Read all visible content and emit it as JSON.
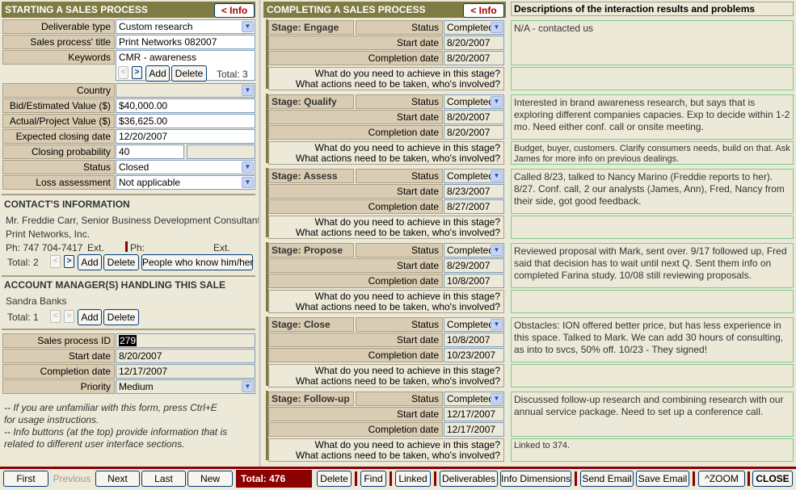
{
  "left": {
    "title": "STARTING A SALES PROCESS",
    "info_label": "< Info",
    "fields": {
      "deliverable_type": {
        "label": "Deliverable type",
        "value": "Custom research"
      },
      "title": {
        "label": "Sales process' title",
        "value": "Print Networks 082007"
      },
      "keywords": {
        "label": "Keywords",
        "value": "CMR - awareness"
      },
      "country": {
        "label": "Country",
        "value": ""
      },
      "bid_value": {
        "label": "Bid/Estimated Value ($)",
        "value": "$40,000.00"
      },
      "actual_value": {
        "label": "Actual/Project Value ($)",
        "value": "$36,625.00"
      },
      "closing_date": {
        "label": "Expected closing date",
        "value": "12/20/2007"
      },
      "probability": {
        "label": "Closing probability",
        "value": "40"
      },
      "status": {
        "label": "Status",
        "value": "Closed"
      },
      "loss": {
        "label": "Loss assessment",
        "value": "Not applicable"
      }
    },
    "keywords_nav": {
      "prev": "<",
      "next": ">",
      "add": "Add",
      "delete": "Delete",
      "total": "Total: 3"
    },
    "contact": {
      "title": "CONTACT'S INFORMATION",
      "name": "Mr. Freddie Carr, Senior Business Development Consultant",
      "company": "Print Networks, Inc.",
      "ph_label": "Ph:",
      "ph": "747 704-7417",
      "ext_label": "Ext.",
      "ph2_label": "Ph:",
      "ext2_label": "Ext.",
      "total": "Total: 2",
      "prev": "<",
      "next": ">",
      "add": "Add",
      "delete": "Delete",
      "people": "People who know him/her"
    },
    "account": {
      "title": "ACCOUNT MANAGER(S) HANDLING THIS SALE",
      "name": "Sandra Banks",
      "total": "Total: 1",
      "prev": "<",
      "next": ">",
      "add": "Add",
      "delete": "Delete"
    },
    "process": {
      "id": {
        "label": "Sales process ID",
        "value": "279"
      },
      "start": {
        "label": "Start date",
        "value": "8/20/2007"
      },
      "completion": {
        "label": "Completion date",
        "value": "12/17/2007"
      },
      "priority": {
        "label": "Priority",
        "value": "Medium"
      }
    },
    "notes": [
      "-- If you are unfamiliar with this form, press Ctrl+E",
      "for usage instructions.",
      "-- Info buttons (at the top) provide information that is",
      "related to different user interface sections."
    ]
  },
  "center": {
    "title": "COMPLETING A SALES PROCESS",
    "info_label": "< Info",
    "labels": {
      "status": "Status",
      "start": "Start date",
      "completion": "Completion date",
      "q1": "What do you need to achieve in this stage?",
      "q2": "What actions need to be taken, who's involved?"
    },
    "stages": [
      {
        "name": "Stage: Engage",
        "status": "Completed",
        "start": "8/20/2007",
        "completion": "8/20/2007",
        "desc": "N/A - contacted us",
        "answer": ""
      },
      {
        "name": "Stage: Qualify",
        "status": "Completed",
        "start": "8/20/2007",
        "completion": "8/20/2007",
        "desc": "Interested in brand awareness research, but says that is exploring different companies capacies. Exp to decide within 1-2 mo. Need either conf. call or onsite meeting.",
        "answer": "Budget, buyer, customers. Clarify consumers needs, build on that. Ask James for more info on previous dealings."
      },
      {
        "name": "Stage: Assess",
        "status": "Completed",
        "start": "8/23/2007",
        "completion": "8/27/2007",
        "desc": "Called 8/23, talked to Nancy Marino (Freddie reports to her). 8/27. Conf. call, 2 our analysts (James, Ann), Fred, Nancy from their side, got good feedback.",
        "answer": ""
      },
      {
        "name": "Stage: Propose",
        "status": "Completed",
        "start": "8/29/2007",
        "completion": "10/8/2007",
        "desc": "Reviewed proposal with Mark, sent over. 9/17 followed up, Fred said that decision has to wait until next Q. Sent them info on completed Farina study. 10/08 still reviewing proposals.",
        "answer": ""
      },
      {
        "name": "Stage: Close",
        "status": "Completed",
        "start": "10/8/2007",
        "completion": "10/23/2007",
        "desc": "Obstacles: ION offered better price, but has less experience in this space. Talked to Mark. We can add 30 hours of consulting, as into to svcs, 50% off. 10/23 - They signed!",
        "answer": ""
      },
      {
        "name": "Stage: Follow-up",
        "status": "Completed",
        "start": "12/17/2007",
        "completion": "12/17/2007",
        "desc": "Discussed follow-up research and combining research with our annual service package. Need to set up a conference call.",
        "answer": "Linked to 374."
      }
    ]
  },
  "right": {
    "title": "Descriptions of the interaction results and problems"
  },
  "bottom": {
    "first": "First",
    "previous": "Previous",
    "next": "Next",
    "last": "Last",
    "new": "New",
    "total": "Total: 476",
    "delete": "Delete",
    "find": "Find",
    "linked": "Linked",
    "deliverables": "Deliverables",
    "info_dimensions": "Info Dimensions",
    "send_email": "Send Email",
    "save_email": "Save Email",
    "zoom": "^ZOOM",
    "close": "CLOSE"
  }
}
